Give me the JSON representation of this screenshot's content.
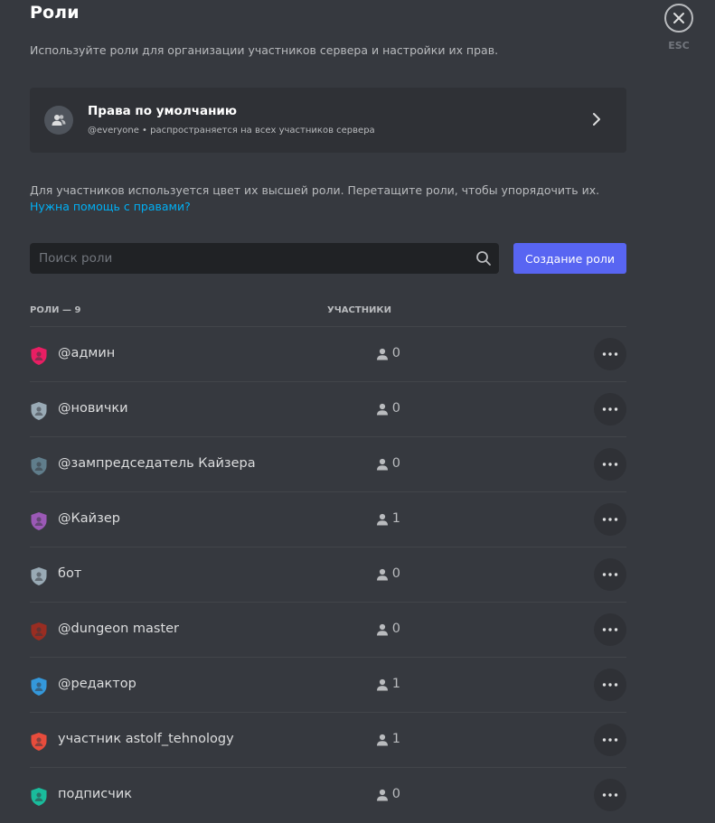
{
  "header": {
    "title": "Роли",
    "subtitle": "Используйте роли для организации участников сервера и настройки их прав.",
    "esc_label": "ESC"
  },
  "default_permissions": {
    "title": "Права по умолчанию",
    "subtitle": "@everyone • распространяется на всех участников сервера"
  },
  "info": {
    "text": "Для участников используется цвет их высшей роли. Перетащите роли, чтобы упорядочить их. ",
    "link": "Нужна помощь с правами?"
  },
  "search": {
    "placeholder": "Поиск роли"
  },
  "create_button": "Создание роли",
  "table": {
    "roles_header": "РОЛИ — 9",
    "members_header": "УЧАСТНИКИ"
  },
  "roles": [
    {
      "name": "@админ",
      "members": "0",
      "color": "#e91e63"
    },
    {
      "name": "@новички",
      "members": "0",
      "color": "#99aab5"
    },
    {
      "name": "@зампредседатель Кайзера",
      "members": "0",
      "color": "#607d8b"
    },
    {
      "name": "@Кайзер",
      "members": "1",
      "color": "#9b59b6"
    },
    {
      "name": "бот",
      "members": "0",
      "color": "#99aab5"
    },
    {
      "name": "@dungeon master",
      "members": "0",
      "color": "#992d22"
    },
    {
      "name": "@редактор",
      "members": "1",
      "color": "#3498db"
    },
    {
      "name": "участник astolf_tehnology",
      "members": "1",
      "color": "#e74c3c"
    },
    {
      "name": "подписчик",
      "members": "0",
      "color": "#1abc9c"
    }
  ],
  "icons": {
    "close": "close-icon",
    "default_avatar": "members-icon",
    "chevron": "chevron-right-icon",
    "search": "search-icon",
    "role": "shield-icon",
    "member": "person-icon",
    "more": "more-horizontal-icon"
  }
}
